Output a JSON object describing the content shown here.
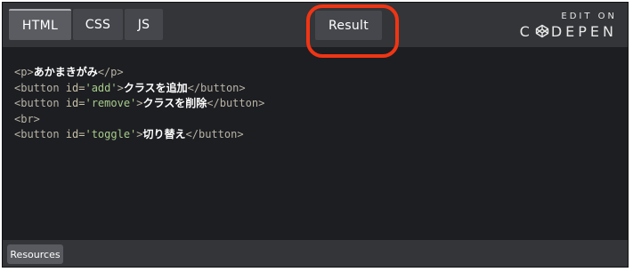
{
  "tabs": {
    "html": "HTML",
    "css": "CSS",
    "js": "JS",
    "result": "Result"
  },
  "brand": {
    "edit_on": "EDIT ON",
    "codepen_pre": "C",
    "codepen_post": "DEPEN"
  },
  "code_lines": [
    [
      {
        "t": "tag",
        "v": "<p>"
      },
      {
        "t": "txt",
        "v": "あかまきがみ"
      },
      {
        "t": "tag",
        "v": "</p>"
      }
    ],
    [
      {
        "t": "tag",
        "v": "<button "
      },
      {
        "t": "attr",
        "v": "id="
      },
      {
        "t": "str",
        "v": "'add'"
      },
      {
        "t": "tag",
        "v": ">"
      },
      {
        "t": "txt",
        "v": "クラスを追加"
      },
      {
        "t": "tag",
        "v": "</button>"
      }
    ],
    [
      {
        "t": "tag",
        "v": "<button "
      },
      {
        "t": "attr",
        "v": "id="
      },
      {
        "t": "str",
        "v": "'remove'"
      },
      {
        "t": "tag",
        "v": ">"
      },
      {
        "t": "txt",
        "v": "クラスを削除"
      },
      {
        "t": "tag",
        "v": "</button>"
      }
    ],
    [
      {
        "t": "tag",
        "v": "<br>"
      }
    ],
    [
      {
        "t": "tag",
        "v": "<button "
      },
      {
        "t": "attr",
        "v": "id="
      },
      {
        "t": "str",
        "v": "'toggle'"
      },
      {
        "t": "tag",
        "v": ">"
      },
      {
        "t": "txt",
        "v": "切り替え"
      },
      {
        "t": "tag",
        "v": "</button>"
      }
    ]
  ],
  "footer": {
    "resources": "Resources"
  },
  "colors": {
    "highlight": "#f03515",
    "background": "#1d1e22",
    "bar": "#333538"
  }
}
